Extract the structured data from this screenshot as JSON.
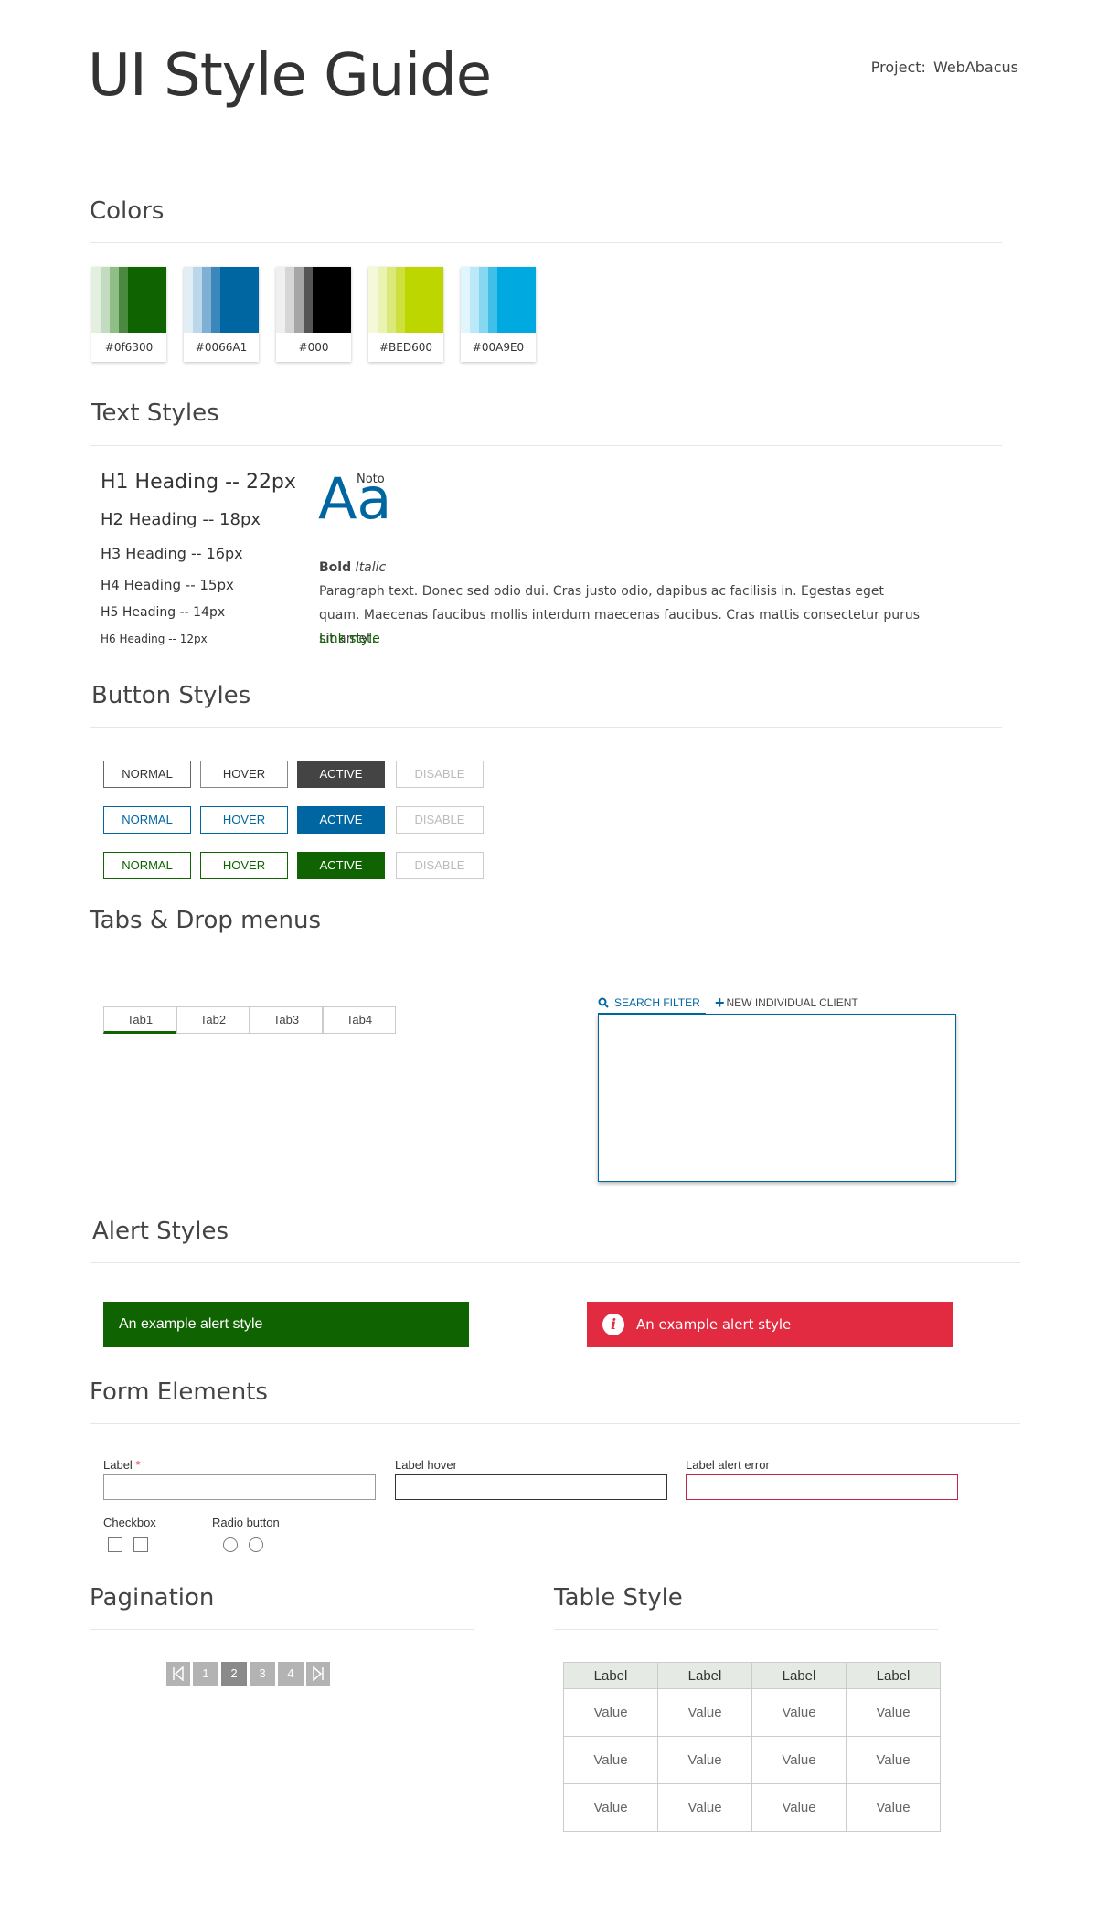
{
  "header": {
    "title": "UI Style Guide",
    "project_label": "Project:",
    "project_value": "WebAbacus"
  },
  "sections": {
    "colors": "Colors",
    "text_styles": "Text Styles",
    "button_styles": "Button Styles",
    "tabs": "Tabs & Drop menus",
    "alerts": "Alert Styles",
    "forms": "Form Elements",
    "pagination": "Pagination",
    "table": "Table Style"
  },
  "colors": [
    {
      "hex": "#0f6300",
      "label": "#0f6300",
      "tints": [
        "#e3f0e0",
        "#c3dcbf",
        "#8fbf87",
        "#4a8a3e",
        "#0f6300"
      ]
    },
    {
      "hex": "#0066A1",
      "label": "#0066A1",
      "tints": [
        "#e2eef6",
        "#bcd7ea",
        "#7fb0d4",
        "#3a87bc",
        "#0066A1"
      ]
    },
    {
      "hex": "#000",
      "label": "#000",
      "tints": [
        "#f0f0f0",
        "#d6d6d6",
        "#a6a6a6",
        "#555555",
        "#000000"
      ]
    },
    {
      "hex": "#BED600",
      "label": "#BED600",
      "tints": [
        "#f5f9d9",
        "#ebf3b3",
        "#dbe97a",
        "#cde03d",
        "#BED600"
      ]
    },
    {
      "hex": "#00A9E0",
      "label": "#00A9E0",
      "tints": [
        "#e0f5fc",
        "#bce9f7",
        "#86d7f0",
        "#40c0e8",
        "#00A9E0"
      ]
    }
  ],
  "text_styles": {
    "h1": "H1 Heading -- 22px",
    "h2": "H2 Heading -- 18px",
    "h3": "H3 Heading -- 16px",
    "h4": "H4 Heading -- 15px",
    "h5": "H5 Heading -- 14px",
    "h6": "H6 Heading -- 12px",
    "font_sample": "Aa",
    "font_name": "Noto",
    "bold": "Bold",
    "italic": "Italic",
    "paragraph": "Paragraph text. Donec sed odio dui. Cras justo odio, dapibus ac facilisis in. Egestas eget quam. Maecenas faucibus mollis interdum maecenas faucibus. Cras mattis consectetur purus sit amet.",
    "link": "Link style"
  },
  "buttons": {
    "normal": "NORMAL",
    "hover": "HOVER",
    "active": "ACTIVE",
    "disable": "DISABLE",
    "accents": [
      "#444444",
      "#0066A1",
      "#0f6300"
    ]
  },
  "tabs": [
    "Tab1",
    "Tab2",
    "Tab3",
    "Tab4"
  ],
  "drop_menu": {
    "search_filter": "SEARCH FILTER",
    "new_client": "NEW INDIVIDUAL CLIENT"
  },
  "alerts": {
    "success": "An example alert style",
    "error": "An example alert style",
    "success_color": "#0f6300",
    "error_color": "#e22a40"
  },
  "form": {
    "label": "Label",
    "required_mark": "*",
    "label_hover": "Label hover",
    "label_error": "Label alert error",
    "checkbox": "Checkbox",
    "radio": "Radio button"
  },
  "pagination": {
    "pages": [
      "1",
      "2",
      "3",
      "4"
    ],
    "current": "2"
  },
  "table": {
    "headers": [
      "Label",
      "Label",
      "Label",
      "Label"
    ],
    "rows": [
      [
        "Value",
        "Value",
        "Value",
        "Value"
      ],
      [
        "Value",
        "Value",
        "Value",
        "Value"
      ],
      [
        "Value",
        "Value",
        "Value",
        "Value"
      ]
    ]
  }
}
